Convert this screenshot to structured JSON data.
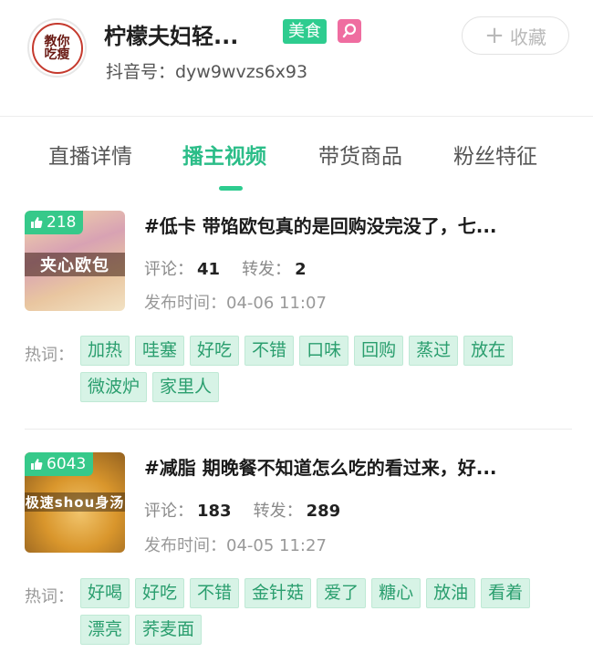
{
  "header": {
    "avatar_text": "教你吃瘦",
    "title": "柠檬夫妇轻...",
    "category_tag": "美食",
    "category_icon": "search-icon",
    "favorite_label": "收藏",
    "douyin_id": "抖音号：dyw9wvzs6x93"
  },
  "tabs": [
    "直播详情",
    "播主视频",
    "带货商品",
    "粉丝特征"
  ],
  "active_tab": "播主视频",
  "colors": {
    "accent": "#2ecc8f",
    "tag_pink": "#ef6da0"
  },
  "videos": [
    {
      "likes": "218",
      "thumb_text": "夹心欧包",
      "title": "#低卡 带馅欧包真的是回购没完没了，七...",
      "comments_label": "评论：",
      "comments": "41",
      "shares_label": "转发：",
      "shares": "2",
      "publish_time": "发布时间：04-06 11:07",
      "hotword_label": "热词：",
      "hotwords": [
        "加热",
        "哇塞",
        "好吃",
        "不错",
        "口味",
        "回购",
        "蒸过",
        "放在",
        "微波炉",
        "家里人"
      ]
    },
    {
      "likes": "6043",
      "thumb_text": "极速shou身汤",
      "title": "#减脂 期晚餐不知道怎么吃的看过来，好...",
      "comments_label": "评论：",
      "comments": "183",
      "shares_label": "转发：",
      "shares": "289",
      "publish_time": "发布时间：04-05 11:27",
      "hotword_label": "热词：",
      "hotwords": [
        "好喝",
        "好吃",
        "不错",
        "金针菇",
        "爱了",
        "糖心",
        "放油",
        "看着",
        "漂亮",
        "荞麦面"
      ]
    }
  ]
}
